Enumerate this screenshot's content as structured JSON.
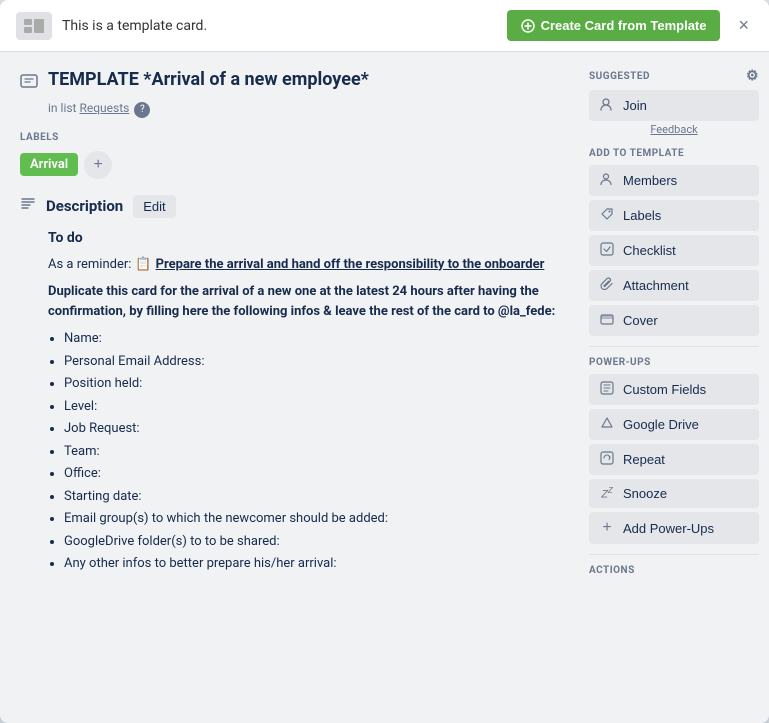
{
  "banner": {
    "text": "This is a template card.",
    "create_btn_label": "Create Card from Template",
    "close_label": "×"
  },
  "card": {
    "title": "TEMPLATE *Arrival of a new employee*",
    "list_prefix": "in list",
    "list_name": "Requests",
    "list_badge": "?"
  },
  "labels_section": {
    "heading": "LABELS",
    "label": "Arrival",
    "add_label": "+"
  },
  "description": {
    "heading": "Description",
    "edit_label": "Edit",
    "todo_heading": "To do",
    "reminder_prefix": "As a reminder:",
    "reminder_link": "Prepare the arrival and hand off the responsibility to the onboarder",
    "bold_paragraph": "Duplicate this card for the arrival of a new one at the latest 24 hours after having the confirmation, by filling here the following infos & leave the rest of the card to @la_fede:",
    "bullets": [
      "Name:",
      "Personal Email Address:",
      "Position held:",
      "Level:",
      "Job Request:",
      "Team:",
      "Office:",
      "Starting date:",
      "Email group(s) to which the newcomer should be added:",
      "GoogleDrive folder(s) to to be shared:",
      "Any other infos to better prepare his/her arrival:"
    ]
  },
  "suggested": {
    "heading": "SUGGESTED",
    "join_label": "Join",
    "feedback_label": "Feedback"
  },
  "add_to_template": {
    "heading": "ADD TO TEMPLATE",
    "items": [
      {
        "icon": "👤",
        "label": "Members"
      },
      {
        "icon": "🏷️",
        "label": "Labels"
      },
      {
        "icon": "☑️",
        "label": "Checklist"
      },
      {
        "icon": "📎",
        "label": "Attachment"
      },
      {
        "icon": "🖼️",
        "label": "Cover"
      }
    ]
  },
  "power_ups": {
    "heading": "POWER-UPS",
    "items": [
      {
        "icon": "⊟",
        "label": "Custom Fields"
      },
      {
        "icon": "△",
        "label": "Google Drive"
      },
      {
        "icon": "⊡",
        "label": "Repeat"
      },
      {
        "icon": "Z",
        "label": "Snooze"
      },
      {
        "icon": "+",
        "label": "Add Power-Ups"
      }
    ]
  },
  "actions": {
    "heading": "ACTIONS"
  }
}
